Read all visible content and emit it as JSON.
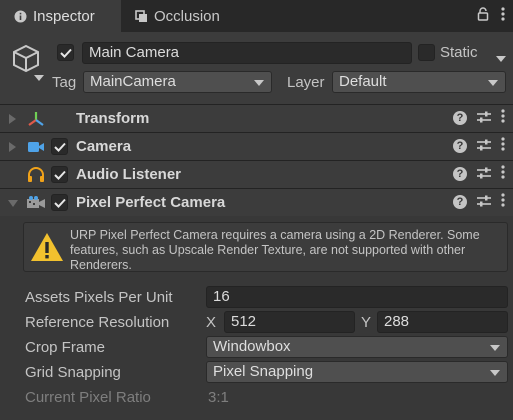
{
  "tabs": [
    {
      "label": "Inspector",
      "icon": "info-icon"
    },
    {
      "label": "Occlusion",
      "icon": "occlusion-icon"
    }
  ],
  "header": {
    "name": "Main Camera",
    "active_checked": true,
    "static_label": "Static",
    "static_checked": false,
    "tag_label": "Tag",
    "tag_value": "MainCamera",
    "layer_label": "Layer",
    "layer_value": "Default"
  },
  "components": [
    {
      "title": "Transform",
      "icon": "transform-axes-icon",
      "has_checkbox": false,
      "expanded": false
    },
    {
      "title": "Camera",
      "icon": "camera-icon",
      "has_checkbox": true,
      "checked": true,
      "expanded": false
    },
    {
      "title": "Audio Listener",
      "icon": "headphones-icon",
      "has_checkbox": true,
      "checked": true,
      "expanded": false
    },
    {
      "title": "Pixel Perfect Camera",
      "icon": "pixel-camera-icon",
      "has_checkbox": true,
      "checked": true,
      "expanded": true
    }
  ],
  "pixel_perfect": {
    "warning": "URP Pixel Perfect Camera requires a camera using a 2D Renderer. Some features, such as Upscale Render Texture, are not supported with other Renderers.",
    "assets_ppu_label": "Assets Pixels Per Unit",
    "assets_ppu_value": "16",
    "ref_res_label": "Reference Resolution",
    "ref_x_label": "X",
    "ref_x_value": "512",
    "ref_y_label": "Y",
    "ref_y_value": "288",
    "crop_label": "Crop Frame",
    "crop_value": "Windowbox",
    "grid_label": "Grid Snapping",
    "grid_value": "Pixel Snapping",
    "ratio_label": "Current Pixel Ratio",
    "ratio_value": "3:1"
  },
  "colors": {
    "accent_blue": "#4fa3e8",
    "warning_yellow": "#f2c12e",
    "transform_red": "#e05a4a",
    "transform_green": "#6fcf55",
    "audio_orange": "#f0a21a"
  }
}
